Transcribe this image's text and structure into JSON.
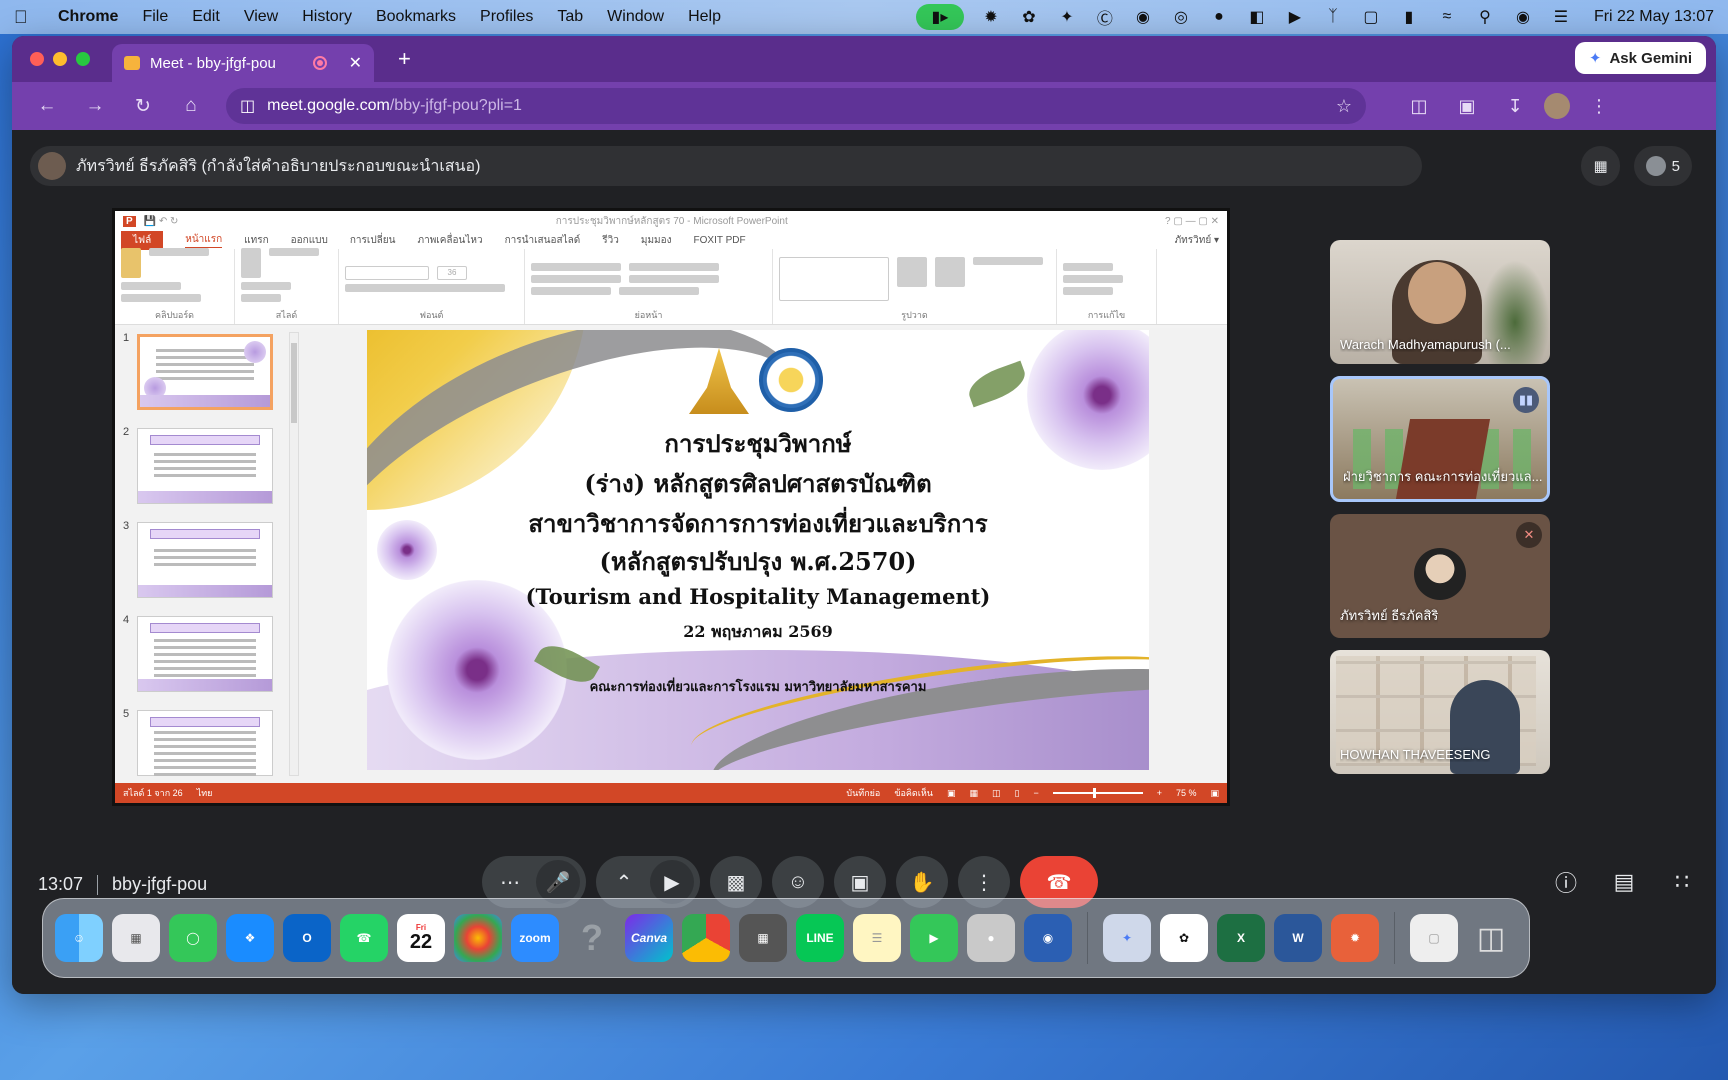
{
  "menubar": {
    "app": "Chrome",
    "items": [
      "File",
      "Edit",
      "View",
      "History",
      "Bookmarks",
      "Profiles",
      "Tab",
      "Window",
      "Help"
    ],
    "datetime": "Fri 22 May  13:07"
  },
  "browser": {
    "tab_title": "Meet - bby-jfgf-pou",
    "ask_gemini": "Ask Gemini",
    "url_host": "meet.google.com",
    "url_path": "/bby-jfgf-pou?pli=1"
  },
  "meet": {
    "presenter_caption": "ภัทรวิทย์ ธีรภัคสิริ (กำลังใส่คำอธิบายประกอบขณะนำเสนอ)",
    "participant_count": "5",
    "time": "13:07",
    "meeting_code": "bby-jfgf-pou",
    "tiles": [
      {
        "name": "Warach Madhyamapurush (..."
      },
      {
        "name": "ฝ่ายวิชาการ คณะการท่องเที่ยวแล..."
      },
      {
        "name": "ภัทรวิทย์ ธีรภัคสิริ"
      },
      {
        "name": "HOWHAN THAVEESENG"
      }
    ]
  },
  "powerpoint": {
    "window_title": "การประชุมวิพากษ์หลักสูตร 70 - Microsoft PowerPoint",
    "user": "ภัทรวิทย์ ▾",
    "tabs": [
      "ไฟล์",
      "หน้าแรก",
      "แทรก",
      "ออกแบบ",
      "การเปลี่ยน",
      "ภาพเคลื่อนไหว",
      "การนำเสนอสไลด์",
      "รีวิว",
      "มุมมอง",
      "FOXIT PDF"
    ],
    "groups": [
      "คลิปบอร์ด",
      "สไลด์",
      "ฟอนต์",
      "ย่อหน้า",
      "รูปวาด",
      "การแก้ไข"
    ],
    "font_size": "36",
    "slide_numbers": [
      "1",
      "2",
      "3",
      "4",
      "5"
    ],
    "status_left": "สไลด์ 1 จาก 26",
    "status_lang": "ไทย",
    "status_notes": "บันทึกย่อ",
    "status_comments": "ข้อคิดเห็น",
    "zoom": "75 %",
    "slide": {
      "line1": "การประชุมวิพากษ์",
      "line2": "(ร่าง) หลักสูตรศิลปศาสตรบัณฑิต",
      "line3": "สาขาวิชาการจัดการการท่องเที่ยวและบริการ",
      "line4": "(หลักสูตรปรับปรุง พ.ศ.2570)",
      "line5": "(Tourism and Hospitality Management)",
      "date": "22 พฤษภาคม 2569",
      "faculty": "คณะการท่องเที่ยวและการโรงแรม มหาวิทยาลัยมหาสารคาม"
    }
  },
  "dock": {
    "calendar_month": "Fri",
    "calendar_day": "22",
    "zoom_label": "zoom",
    "canva_label": "Canva"
  }
}
